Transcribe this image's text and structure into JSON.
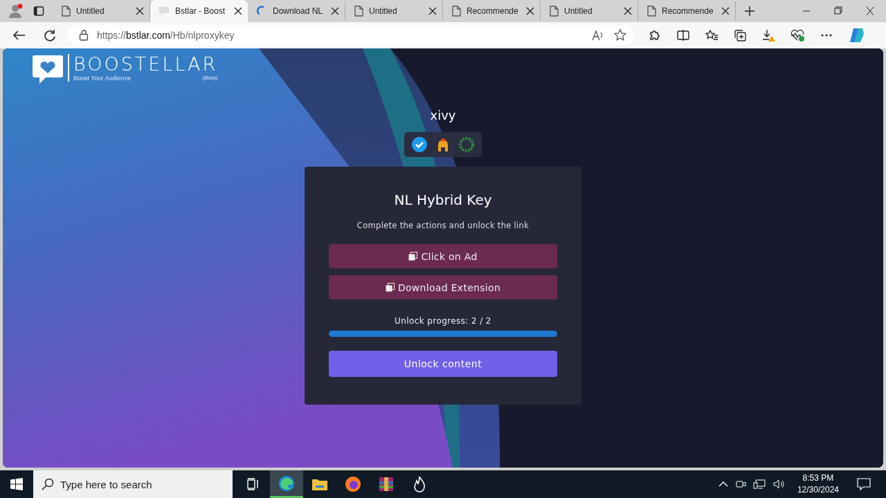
{
  "browser": {
    "tabs": [
      {
        "title": "Untitled",
        "kind": "page",
        "selected": false
      },
      {
        "title": "Bstlar - Boost",
        "kind": "site",
        "selected": true
      },
      {
        "title": "Download NL",
        "kind": "loading",
        "selected": false
      },
      {
        "title": "Untitled",
        "kind": "page",
        "selected": false
      },
      {
        "title": "Recommende",
        "kind": "page",
        "selected": false
      },
      {
        "title": "Untitled",
        "kind": "page",
        "selected": false
      },
      {
        "title": "Recommende",
        "kind": "page",
        "selected": false
      }
    ],
    "address": {
      "scheme": "https://",
      "host": "bstlar.com",
      "path": "/Hb/nlproxykey"
    }
  },
  "page": {
    "logo": {
      "name": "BOOSTELLAR",
      "tagline": "Boost Your Audience",
      "beta": "(Beta)"
    },
    "username": "xivy",
    "card": {
      "title": "NL Hybrid Key",
      "subtitle": "Complete the actions and unlock the link",
      "actions": [
        {
          "label": "Click on Ad"
        },
        {
          "label": "Download Extension"
        }
      ],
      "progress_label": "Unlock progress: 2 / 2",
      "level": 1,
      "unlock_button": "Unlock content"
    }
  },
  "taskbar": {
    "search_placeholder": "Type here to search",
    "time": "8:53 PM",
    "date": "12/30/2024"
  }
}
